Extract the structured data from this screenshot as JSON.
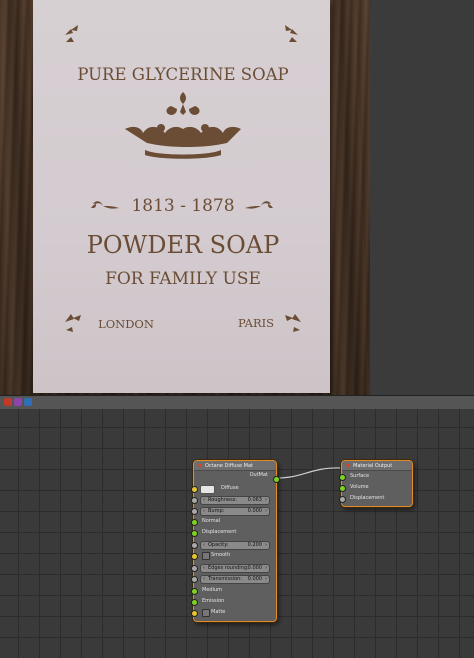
{
  "viewport": {
    "texture": {
      "title": "PURE GLYCERINE SOAP",
      "years": "1813 - 1878",
      "headline": "POWDER SOAP",
      "subline": "FOR FAMILY USE",
      "left_city": "LONDON",
      "right_city": "PARIS"
    }
  },
  "header_buttons": [
    {
      "color": "#c0392b"
    },
    {
      "color": "#8e44ad"
    },
    {
      "color": "#2f6fb5"
    }
  ],
  "diffuse_node": {
    "title": "Octane Diffuse Mat",
    "output": "OutMat",
    "rows": {
      "diffuse": "Diffuse",
      "roughness_label": "Roughness:",
      "roughness_value": "0.063",
      "bump_label": "Bump:",
      "bump_value": "0.000",
      "normal": "Normal",
      "displacement": "Displacement",
      "opacity_label": "Opacity:",
      "opacity_value": "0.200",
      "smooth": "Smooth",
      "edges_label": "Edges rounding:",
      "edges_value": "0.000",
      "transmission_label": "Transmission:",
      "transmission_value": "0.000",
      "medium": "Medium",
      "emission": "Emission",
      "matte": "Matte"
    }
  },
  "output_node": {
    "title": "Material Output",
    "inputs": [
      "Surface",
      "Volume",
      "Displacement"
    ]
  },
  "colors": {
    "node_border": "#e08a2a",
    "socket_green": "#7ed321",
    "socket_yellow": "#e8c330",
    "socket_grey": "#a9a9a9",
    "link": "#cfcfcf"
  }
}
